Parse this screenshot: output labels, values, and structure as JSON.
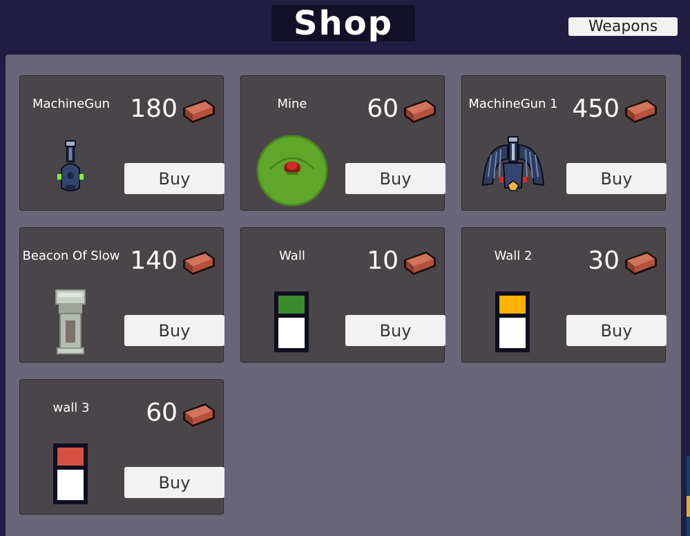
{
  "header": {
    "title": "Shop",
    "weapons_label": "Weapons"
  },
  "currency_icon": "brick-icon",
  "items": [
    {
      "name": "MachineGun",
      "price": "180",
      "buy_label": "Buy",
      "icon": "machine-gun-turret-icon"
    },
    {
      "name": "Mine",
      "price": "60",
      "buy_label": "Buy",
      "icon": "mine-icon"
    },
    {
      "name": "MachineGun 1",
      "price": "450",
      "buy_label": "Buy",
      "icon": "winged-turret-icon"
    },
    {
      "name": "Beacon Of Slow",
      "price": "140",
      "buy_label": "Buy",
      "icon": "beacon-tower-icon"
    },
    {
      "name": "Wall",
      "price": "10",
      "buy_label": "Buy",
      "icon": "wall-icon",
      "wall_color": "#3a8a2e"
    },
    {
      "name": "Wall 2",
      "price": "30",
      "buy_label": "Buy",
      "icon": "wall-icon",
      "wall_color": "#ffb300"
    },
    {
      "name": "wall 3",
      "price": "60",
      "buy_label": "Buy",
      "icon": "wall-icon",
      "wall_color": "#d65143"
    }
  ],
  "colors": {
    "background": "#201c42",
    "panel": "#686578",
    "card": "#4a4549",
    "button": "#f2f2f2",
    "brick": "#b5523d"
  }
}
